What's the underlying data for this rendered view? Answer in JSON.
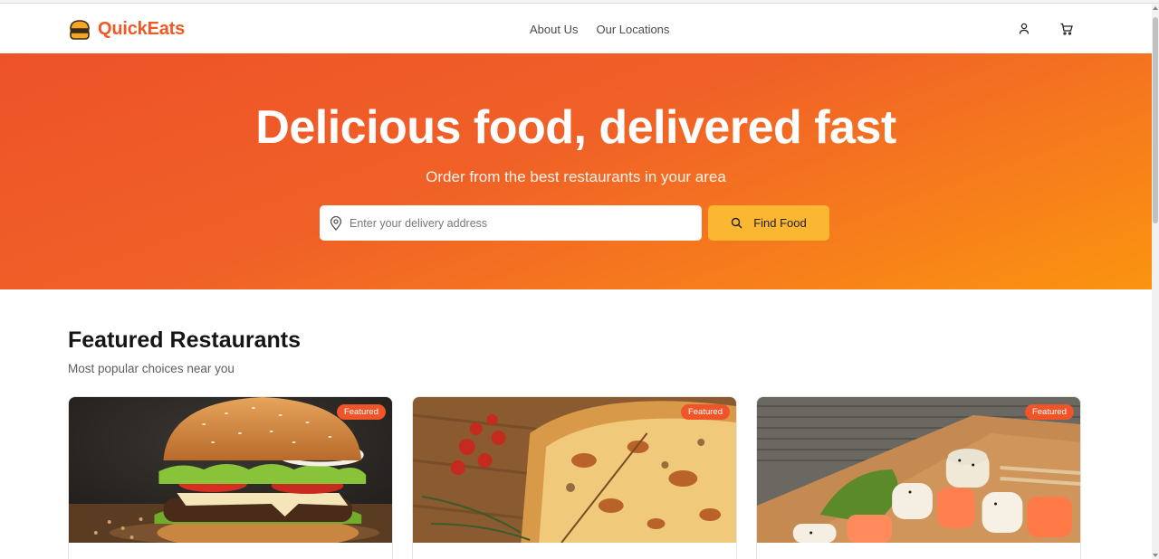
{
  "header": {
    "logo_text": "QuickEats",
    "nav": [
      "About Us",
      "Our Locations"
    ],
    "icons": [
      "user-icon",
      "cart-icon"
    ]
  },
  "hero": {
    "title": "Delicious food, delivered fast",
    "subtitle": "Order from the best restaurants in your area",
    "search_placeholder": "Enter your delivery address",
    "search_value": "",
    "button_label": "Find Food"
  },
  "featured": {
    "title": "Featured Restaurants",
    "subtitle": "Most popular choices near you",
    "cards": [
      {
        "badge": "Featured",
        "image": "burger-photo"
      },
      {
        "badge": "Featured",
        "image": "pizza-photo"
      },
      {
        "badge": "Featured",
        "image": "sushi-photo"
      }
    ]
  },
  "colors": {
    "brand": "#ef5a24",
    "hero_start": "#ee5229",
    "hero_end": "#fb9410",
    "button": "#fbb731",
    "badge": "#ee5529"
  }
}
